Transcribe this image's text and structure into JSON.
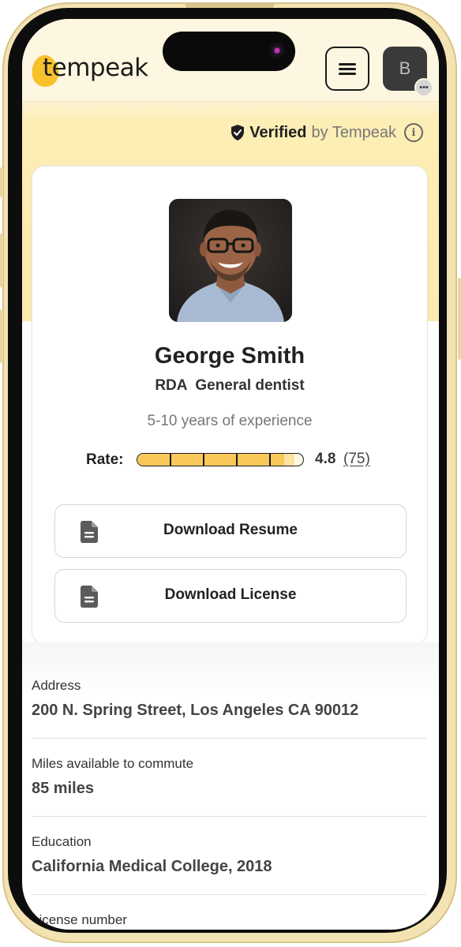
{
  "header": {
    "logo_text": "tempeak",
    "avatar_initial": "B",
    "avatar_badge": "•••"
  },
  "verification": {
    "strong": "Verified",
    "rest": "by Tempeak",
    "info_glyph": "i"
  },
  "profile": {
    "name": "George Smith",
    "role": "RDA  General dentist",
    "experience": "5-10 years of experience",
    "rate_label": "Rate:",
    "rating": "4.8",
    "rating_count": "(75)",
    "rating_fraction": 0.96
  },
  "actions": {
    "download_resume": "Download Resume",
    "download_license": "Download License"
  },
  "details": [
    {
      "label": "Address",
      "value": "200 N. Spring Street, Los Angeles CA 90012"
    },
    {
      "label": "Miles available to commute",
      "value": "85 miles"
    },
    {
      "label": "Education",
      "value": "California Medical College, 2018"
    },
    {
      "label": "License number",
      "value": ""
    }
  ],
  "colors": {
    "brand_yellow": "#f6c12b",
    "rating_fill": "#f8c85a",
    "hero_background": "#fdeab0"
  },
  "icons": {
    "menu": "hamburger-icon",
    "verified": "shield-check-icon",
    "info": "info-icon",
    "document": "document-icon"
  }
}
